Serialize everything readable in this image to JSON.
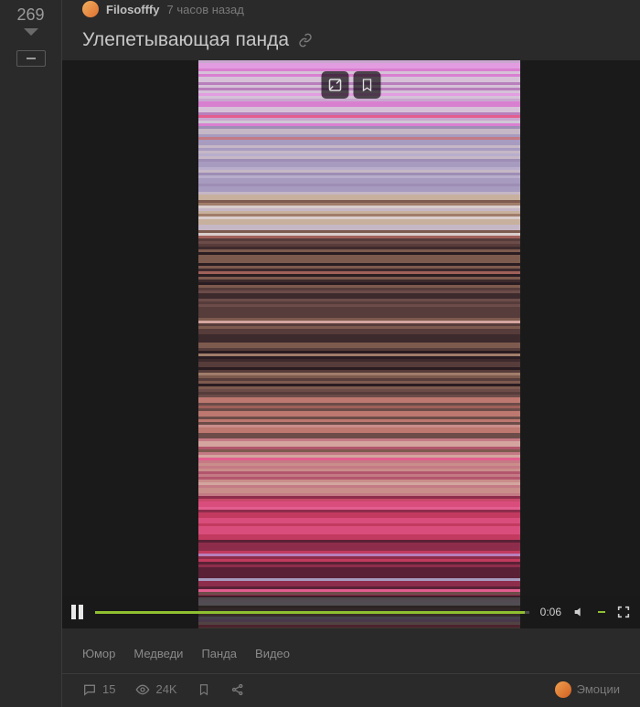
{
  "vote": {
    "score": "269"
  },
  "post": {
    "author": "Filosofffy",
    "time": "7 часов назад",
    "title": "Улепетывающая панда"
  },
  "player": {
    "time": "0:06"
  },
  "tags": [
    "Юмор",
    "Медведи",
    "Панда",
    "Видео"
  ],
  "footer": {
    "comments": "15",
    "views": "24K",
    "emotions_label": "Эмоции"
  }
}
